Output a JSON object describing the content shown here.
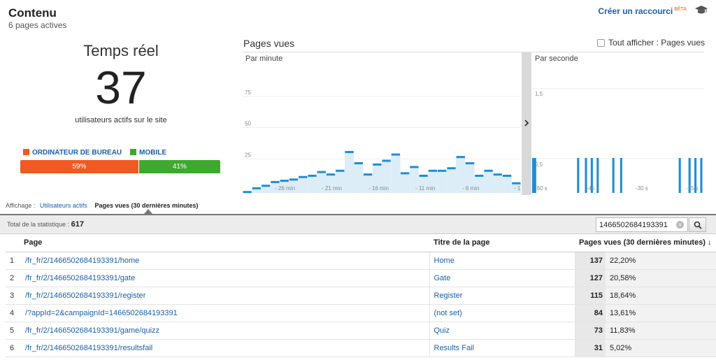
{
  "header": {
    "title": "Contenu",
    "subtitle": "6 pages actives",
    "shortcut_label": "Créer un raccourci",
    "shortcut_badge": "BÊTA",
    "cap_icon": "graduation-cap-icon"
  },
  "realtime": {
    "title": "Temps réel",
    "count": "37",
    "label": "utilisateurs actifs sur le site"
  },
  "devices": {
    "legend": [
      {
        "label": "ORDINATEUR DE BUREAU",
        "color": "#f05a22"
      },
      {
        "label": "MOBILE",
        "color": "#3daa2f"
      }
    ],
    "desktop_pct": "59%",
    "mobile_pct": "41%",
    "desktop_share": 0.59
  },
  "pageviews": {
    "title": "Pages vues",
    "show_all_label": "Tout afficher : Pages vues",
    "show_all_checked": false
  },
  "chart_data": [
    {
      "type": "bar",
      "title": "Par minute",
      "y_ticks": [
        "75",
        "50",
        "25"
      ],
      "ylim": [
        0,
        90
      ],
      "x_tick_labels": [
        "- 26 min",
        "- 21 min",
        "- 16 min",
        "- 11 min",
        "- 6 min",
        "- 1"
      ],
      "values": [
        1,
        4,
        6,
        9,
        10,
        11,
        13,
        14,
        17,
        15,
        18,
        33,
        24,
        15,
        23,
        26,
        31,
        16,
        21,
        14,
        18,
        18,
        20,
        29,
        24,
        14,
        18,
        15,
        14,
        8
      ],
      "color": "#1f8dd6",
      "fill": "#dcedf8"
    },
    {
      "type": "bar",
      "title": "Par seconde",
      "y_ticks": [
        "1,5",
        "0,5"
      ],
      "ylim": [
        0,
        2
      ],
      "x_tick_labels": [
        "-60 s",
        "-45 s",
        "-30 s",
        "-15 s"
      ],
      "values": [
        1,
        1,
        0,
        0,
        0,
        0,
        0,
        0,
        0,
        0,
        0,
        0,
        0,
        0,
        0,
        0,
        0,
        0,
        0,
        0,
        0,
        0,
        0,
        1,
        0,
        0,
        0,
        1,
        0,
        0,
        1,
        0,
        0,
        1,
        0,
        0,
        0,
        0,
        0,
        0,
        0,
        1,
        0,
        0,
        0,
        1,
        0,
        0,
        0,
        0,
        0,
        0,
        0,
        0,
        0,
        0,
        0,
        0,
        0,
        0,
        0,
        0,
        0,
        0,
        0,
        0,
        0,
        0,
        0,
        0,
        0,
        0,
        0,
        0,
        0,
        1,
        0,
        0,
        0,
        0,
        1,
        0,
        0,
        1,
        0,
        0,
        1,
        0
      ],
      "color": "#1f8dd6"
    }
  ],
  "view": {
    "prefix": "Affichage :",
    "option_users": "Utilisateurs actifs",
    "option_pageviews": "Pages vues (30 dernières minutes)"
  },
  "totals": {
    "label": "Total de la statistique :",
    "value": "617",
    "search_value": "1466502684193391"
  },
  "table": {
    "headers": [
      "Page",
      "Titre de la page",
      "Pages vues (30 dernières minutes)"
    ],
    "rows": [
      {
        "n": "1",
        "page": "/fr_fr/2/1466502684193391/home",
        "title": "Home",
        "views": "137",
        "pct": "22,20%"
      },
      {
        "n": "2",
        "page": "/fr_fr/2/1466502684193391/gate",
        "title": "Gate",
        "views": "127",
        "pct": "20,58%"
      },
      {
        "n": "3",
        "page": "/fr_fr/2/1466502684193391/register",
        "title": "Register",
        "views": "115",
        "pct": "18,64%"
      },
      {
        "n": "4",
        "page": "/?appId=2&campaignId=1466502684193391",
        "title": "(not set)",
        "views": "84",
        "pct": "13,61%"
      },
      {
        "n": "5",
        "page": "/fr_fr/2/1466502684193391/game/quizz",
        "title": "Quiz",
        "views": "73",
        "pct": "11,83%"
      },
      {
        "n": "6",
        "page": "/fr_fr/2/1466502684193391/resultsfail",
        "title": "Results Fail",
        "views": "31",
        "pct": "5,02%"
      }
    ]
  }
}
